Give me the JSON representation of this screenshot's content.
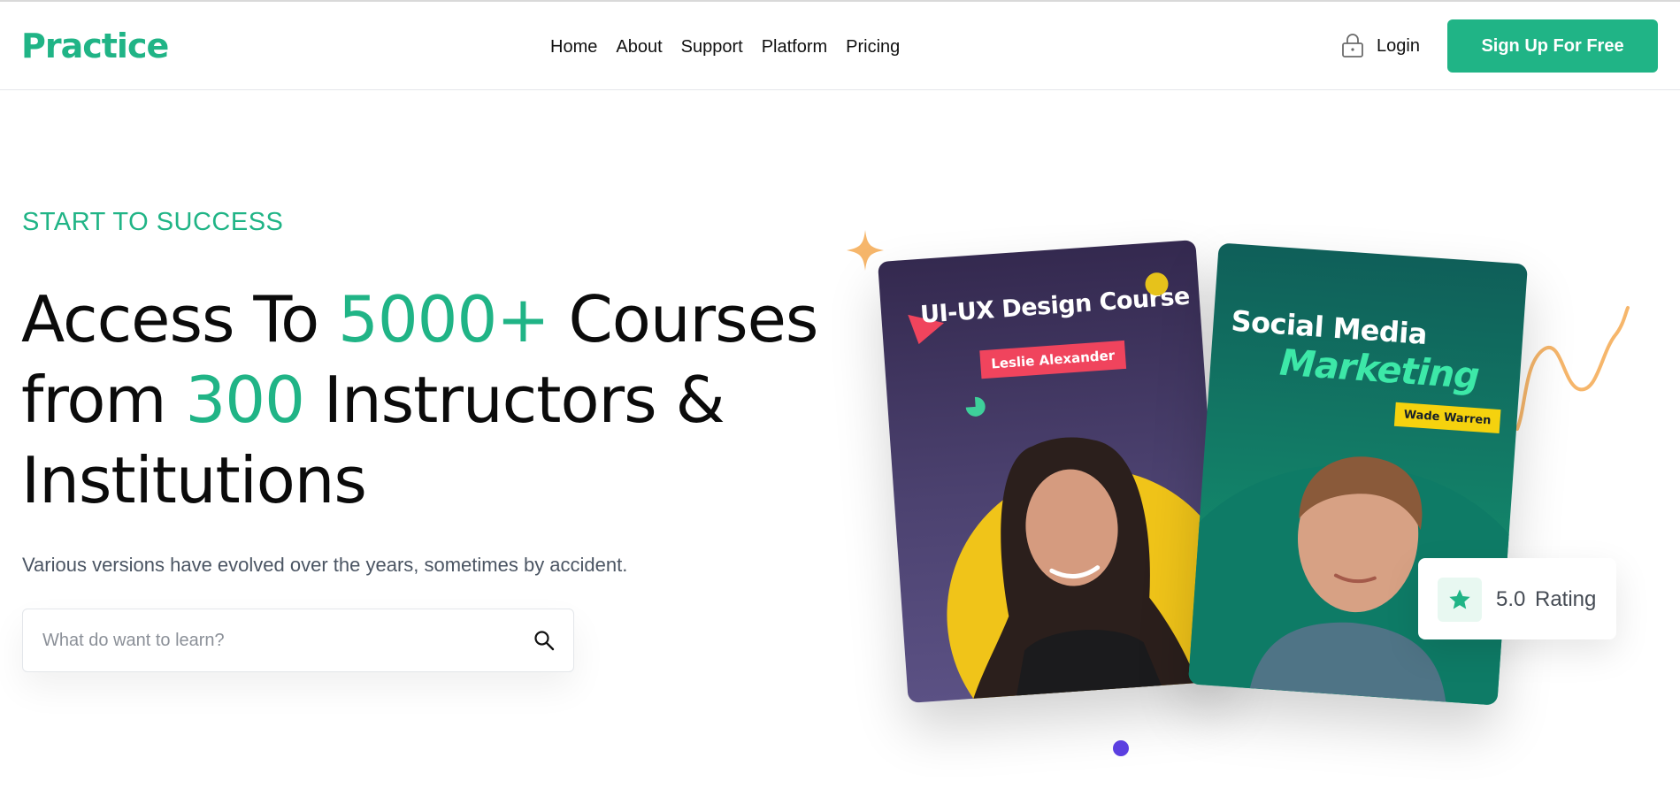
{
  "colors": {
    "brand": "#20b486",
    "text": "#0b0b0b",
    "muted": "#4b5563",
    "tag_red": "#f0445d",
    "tag_yellow": "#f5d20e",
    "pagination_dot": "#5b3fe0",
    "sparkle": "#f6b66b"
  },
  "header": {
    "logo": "Practice",
    "nav": [
      {
        "label": "Home"
      },
      {
        "label": "About"
      },
      {
        "label": "Support"
      },
      {
        "label": "Platform"
      },
      {
        "label": "Pricing"
      }
    ],
    "login_icon": "lock-icon",
    "login_label": "Login",
    "signup_label": "Sign Up For Free"
  },
  "hero": {
    "eyebrow": "START TO SUCCESS",
    "headline": {
      "part1": "Access To ",
      "accent1": "5000+",
      "part2": " Courses from ",
      "accent2": "300",
      "part3": " Instructors & Institutions"
    },
    "subtitle": "Various versions have evolved over the years, sometimes by accident.",
    "search": {
      "placeholder": "What do want to learn?",
      "icon": "search-icon"
    }
  },
  "cards": [
    {
      "title": "UI-UX Design Course",
      "instructor": "Leslie Alexander"
    },
    {
      "title_line1": "Social Media",
      "title_line2": "Marketing",
      "instructor": "Wade Warren"
    }
  ],
  "rating": {
    "icon": "star-icon",
    "value": "5.0",
    "label": "Rating"
  }
}
